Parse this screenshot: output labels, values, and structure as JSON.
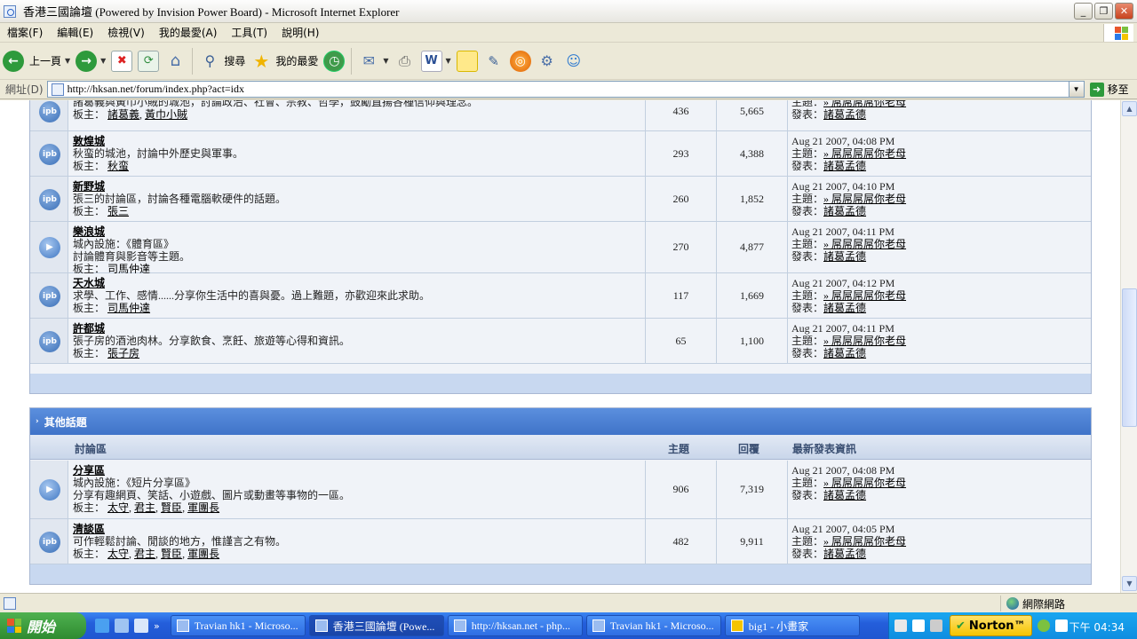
{
  "window": {
    "title": "香港三國論壇 (Powered by Invision Power Board) - Microsoft Internet Explorer"
  },
  "menu": [
    "檔案(F)",
    "編輯(E)",
    "檢視(V)",
    "我的最愛(A)",
    "工具(T)",
    "說明(H)"
  ],
  "toolbar": {
    "back": "上一頁",
    "search": "搜尋",
    "favorites": "我的最愛"
  },
  "address": {
    "label": "網址(D)",
    "url": "http://hksan.net/forum/index.php?act=idx",
    "go": "移至"
  },
  "section1": {
    "forums": [
      {
        "icon": "ipb",
        "name": "",
        "desc": [
          "諸葛義與黃巾小賊的城池，討論政治、社會、宗教、哲學，鼓勵直揚各種信仰與理念。"
        ],
        "mod_label": "板主：",
        "mods": [
          "諸葛義",
          "黃巾小賊"
        ],
        "topics": "436",
        "replies": "5,665",
        "last": {
          "date": "",
          "subject_label": "主題：",
          "subject": "» 屌屌屌屌你老母",
          "author_label": "發表：",
          "author": "諸葛孟德"
        }
      },
      {
        "icon": "ipb",
        "name": "敦煌城",
        "desc": [
          "秋蛮的城池，討論中外歷史與軍事。"
        ],
        "mod_label": "板主：",
        "mods": [
          "秋蛮"
        ],
        "topics": "293",
        "replies": "4,388",
        "last": {
          "date": "Aug 21 2007, 04:08 PM",
          "subject_label": "主題：",
          "subject": "» 屌屌屌屌你老母",
          "author_label": "發表：",
          "author": "諸葛孟德"
        }
      },
      {
        "icon": "ipb",
        "name": "新野城",
        "desc": [
          "張三的討論區，討論各種電腦軟硬件的話題。"
        ],
        "mod_label": "板主：",
        "mods": [
          "張三"
        ],
        "topics": "260",
        "replies": "1,852",
        "last": {
          "date": "Aug 21 2007, 04:10 PM",
          "subject_label": "主題：",
          "subject": "» 屌屌屌屌你老母",
          "author_label": "發表：",
          "author": "諸葛孟德"
        }
      },
      {
        "icon": "play",
        "name": "樂浪城",
        "desc": [
          "城內設施：《體育區》",
          "討論體育與影音等主題。"
        ],
        "mod_label": "板主：",
        "mods": [
          "司馬仲達"
        ],
        "topics": "270",
        "replies": "4,877",
        "last": {
          "date": "Aug 21 2007, 04:11 PM",
          "subject_label": "主題：",
          "subject": "» 屌屌屌屌你老母",
          "author_label": "發表：",
          "author": "諸葛孟德"
        }
      },
      {
        "icon": "ipb",
        "name": "天水城",
        "desc": [
          "求學、工作、感情......分享你生活中的喜與憂。過上難題，亦歡迎來此求助。"
        ],
        "mod_label": "板主：",
        "mods": [
          "司馬仲達"
        ],
        "topics": "117",
        "replies": "1,669",
        "last": {
          "date": "Aug 21 2007, 04:12 PM",
          "subject_label": "主題：",
          "subject": "» 屌屌屌屌你老母",
          "author_label": "發表：",
          "author": "諸葛孟德"
        }
      },
      {
        "icon": "ipb",
        "name": "許都城",
        "desc": [
          "張子房的酒池肉林。分享飲食、烹飪、旅遊等心得和資訊。"
        ],
        "mod_label": "板主：",
        "mods": [
          "張子房"
        ],
        "topics": "65",
        "replies": "1,100",
        "last": {
          "date": "Aug 21 2007, 04:11 PM",
          "subject_label": "主題：",
          "subject": "» 屌屌屌屌你老母",
          "author_label": "發表：",
          "author": "諸葛孟德"
        }
      }
    ]
  },
  "section2": {
    "title": "其他話題",
    "columns": {
      "forum": "討論區",
      "topics": "主題",
      "replies": "回覆",
      "last": "最新發表資訊"
    },
    "forums": [
      {
        "icon": "play",
        "name": "分享區",
        "desc": [
          "城內設施：《短片分享區》",
          "分享有趣網頁、笑話、小遊戲、圖片或動畫等事物的一區。"
        ],
        "mod_label": "板主：",
        "mods": [
          "太守",
          "君主",
          "賢臣",
          "軍團長"
        ],
        "topics": "906",
        "replies": "7,319",
        "last": {
          "date": "Aug 21 2007, 04:08 PM",
          "subject_label": "主題：",
          "subject": "» 屌屌屌屌你老母",
          "author_label": "發表：",
          "author": "諸葛孟德"
        }
      },
      {
        "icon": "ipb",
        "name": "清談區",
        "desc": [
          "可作輕鬆討論、閒談的地方，惟謹言之有物。"
        ],
        "mod_label": "板主：",
        "mods": [
          "太守",
          "君主",
          "賢臣",
          "軍團長"
        ],
        "topics": "482",
        "replies": "9,911",
        "last": {
          "date": "Aug 21 2007, 04:05 PM",
          "subject_label": "主題：",
          "subject": "» 屌屌屌屌你老母",
          "author_label": "發表：",
          "author": "諸葛孟德"
        }
      }
    ]
  },
  "status": {
    "zone": "網際網路"
  },
  "taskbar": {
    "start": "開始",
    "tasks": [
      "Travian hk1 - Microso...",
      "香港三國論壇 (Powe...",
      "http://hksan.net - php...",
      "Travian hk1 - Microso...",
      "big1 - 小畫家"
    ],
    "active_index": 1,
    "norton": "Norton™",
    "clock": "下午 04:34"
  },
  "colors": {
    "category_header": "#3f73c8",
    "row_bg": "#f0f3f8",
    "icon_cell": "#e1e7f0",
    "taskbar": "#245edb",
    "start": "#2e8b30"
  }
}
